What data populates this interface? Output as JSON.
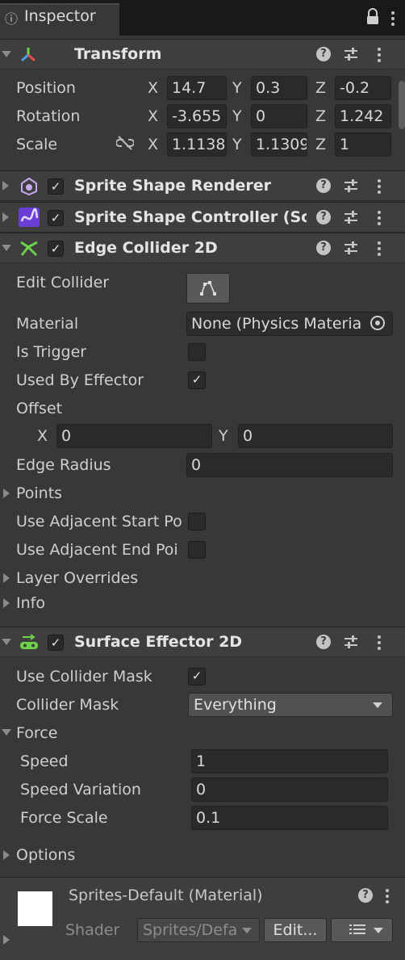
{
  "window": {
    "tab_title": "Inspector",
    "tab_icon": "info-icon"
  },
  "transform": {
    "title": "Transform",
    "position": {
      "label": "Position",
      "x": "14.7",
      "y": "0.3",
      "z": "-0.2"
    },
    "rotation": {
      "label": "Rotation",
      "x": "-3.655",
      "y": "0",
      "z": "1.242"
    },
    "scale": {
      "label": "Scale",
      "x": "1.1138",
      "y": "1.1309",
      "z": "1"
    },
    "axis_x": "X",
    "axis_y": "Y",
    "axis_z": "Z"
  },
  "sprite_shape_renderer": {
    "title": "Sprite Shape Renderer",
    "enabled": true
  },
  "sprite_shape_controller": {
    "title": "Sprite Shape Controller (Scr",
    "enabled": true
  },
  "edge_collider": {
    "title": "Edge Collider 2D",
    "enabled": true,
    "edit_collider_label": "Edit Collider",
    "material_label": "Material",
    "material_value": "None (Physics Materia",
    "is_trigger_label": "Is Trigger",
    "is_trigger": false,
    "used_by_effector_label": "Used By Effector",
    "used_by_effector": true,
    "offset_label": "Offset",
    "offset_x_label": "X",
    "offset_x": "0",
    "offset_y_label": "Y",
    "offset_y": "0",
    "edge_radius_label": "Edge Radius",
    "edge_radius": "0",
    "points_label": "Points",
    "use_adjacent_start_label": "Use Adjacent Start Po",
    "use_adjacent_start": false,
    "use_adjacent_end_label": "Use Adjacent End Poi",
    "use_adjacent_end": false,
    "layer_overrides_label": "Layer Overrides",
    "info_label": "Info"
  },
  "surface_effector": {
    "title": "Surface Effector 2D",
    "enabled": true,
    "use_collider_mask_label": "Use Collider Mask",
    "use_collider_mask": true,
    "collider_mask_label": "Collider Mask",
    "collider_mask_value": "Everything",
    "force_label": "Force",
    "speed_label": "Speed",
    "speed": "1",
    "speed_variation_label": "Speed Variation",
    "speed_variation": "0",
    "force_scale_label": "Force Scale",
    "force_scale": "0.1",
    "options_label": "Options"
  },
  "material": {
    "title": "Sprites-Default (Material)",
    "shader_label": "Shader",
    "shader_value": "Sprites/Defa",
    "edit_button": "Edit...",
    "preview_color": "#ffffff"
  },
  "colors": {
    "background": "#383838",
    "header": "#3e3e3e",
    "field": "#2a2a2a",
    "accent_transform_red": "#e0524c",
    "accent_green": "#6cd24a",
    "accent_blue": "#4aa0e6"
  }
}
